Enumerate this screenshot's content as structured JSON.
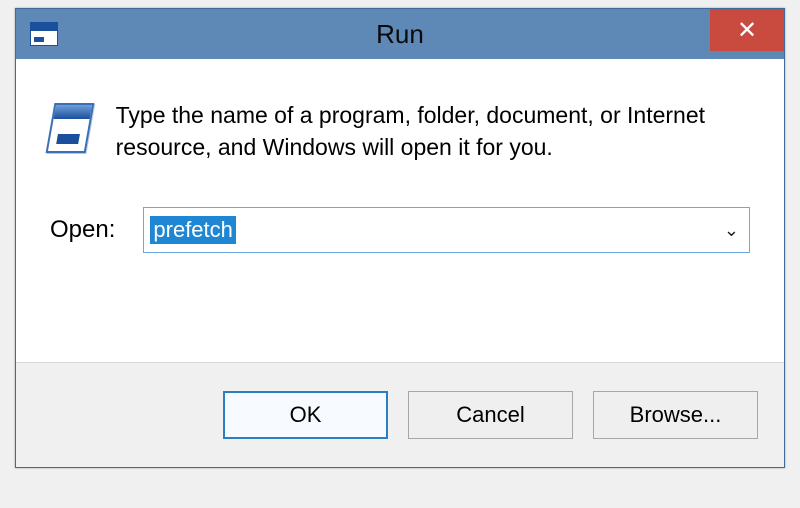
{
  "titlebar": {
    "title": "Run",
    "close_glyph": "✕"
  },
  "content": {
    "description": "Type the name of a program, folder, document, or Internet resource, and Windows will open it for you.",
    "open_label": "Open:",
    "open_value": "prefetch",
    "dropdown_glyph": "⌄"
  },
  "buttons": {
    "ok": "OK",
    "cancel": "Cancel",
    "browse": "Browse..."
  }
}
